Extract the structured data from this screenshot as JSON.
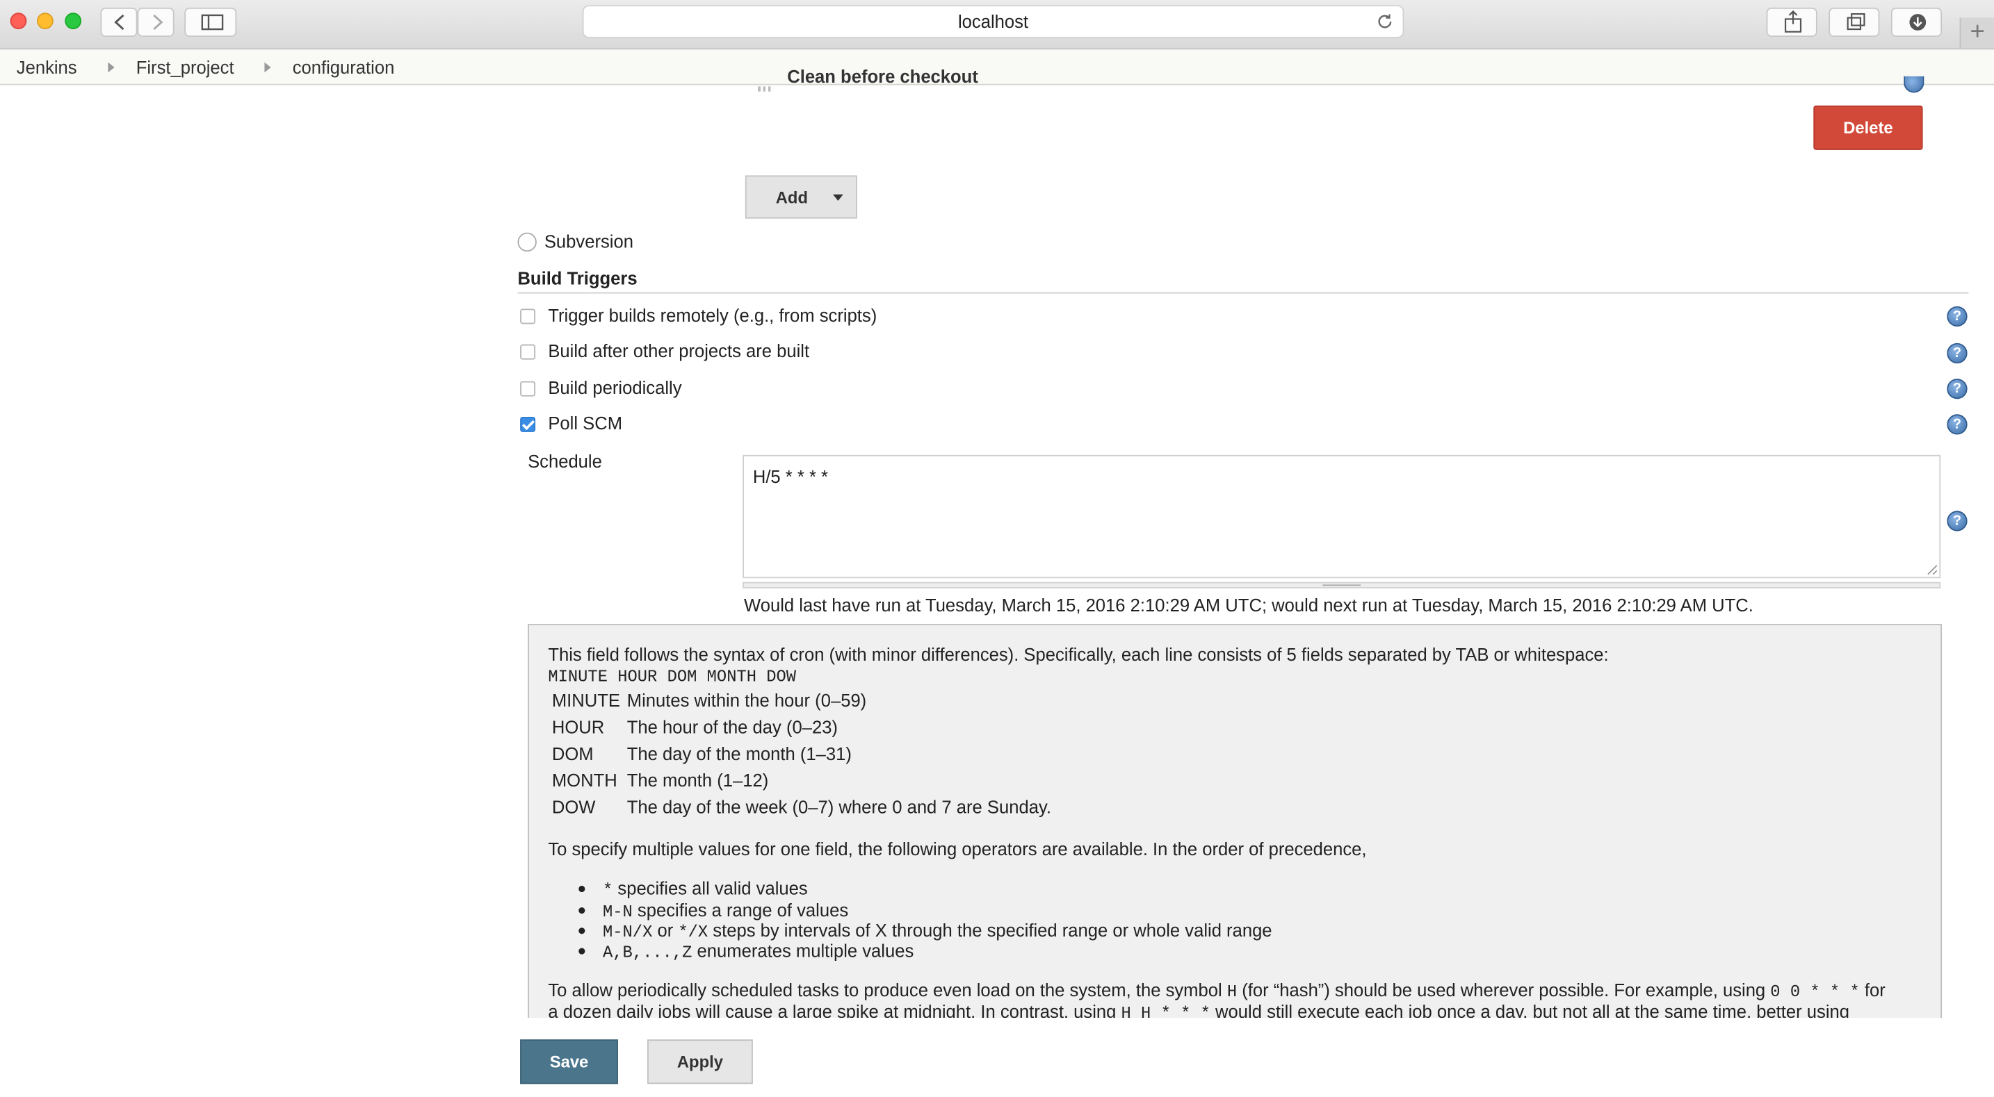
{
  "browser": {
    "url": "localhost",
    "traffic_light_colors": [
      "#fe5f57",
      "#febc2e",
      "#28c840"
    ]
  },
  "breadcrumb": [
    "Jenkins",
    "First_project",
    "configuration"
  ],
  "scm": {
    "cut_off_item": "Clean before checkout",
    "delete_label": "Delete",
    "add_label": "Add",
    "subversion_label": "Subversion"
  },
  "build_triggers": {
    "heading": "Build Triggers",
    "options": [
      {
        "label": "Trigger builds remotely (e.g., from scripts)",
        "checked": false
      },
      {
        "label": "Build after other projects are built",
        "checked": false
      },
      {
        "label": "Build periodically",
        "checked": false
      },
      {
        "label": "Poll SCM",
        "checked": true
      }
    ],
    "schedule_label": "Schedule",
    "schedule_value": "H/5 * * * *",
    "schedule_note": "Would last have run at Tuesday, March 15, 2016 2:10:29 AM UTC; would next run at Tuesday, March 15, 2016 2:10:29 AM UTC."
  },
  "help": {
    "intro": "This field follows the syntax of cron (with minor differences). Specifically, each line consists of 5 fields separated by TAB or whitespace:",
    "format": "MINUTE HOUR DOM MONTH DOW",
    "fields": [
      {
        "name": "MINUTE",
        "desc": "Minutes within the hour (0–59)"
      },
      {
        "name": "HOUR",
        "desc": "The hour of the day (0–23)"
      },
      {
        "name": "DOM",
        "desc": "The day of the month (1–31)"
      },
      {
        "name": "MONTH",
        "desc": "The month (1–12)"
      },
      {
        "name": "DOW",
        "desc": "The day of the week (0–7) where 0 and 7 are Sunday."
      }
    ],
    "operators_intro": "To specify multiple values for one field, the following operators are available. In the order of precedence,",
    "operators": [
      {
        "code": "*",
        "text": " specifies all valid values"
      },
      {
        "code": "M-N",
        "text": " specifies a range of values"
      },
      {
        "code": "M-N/X",
        "mid": " or ",
        "code2": "*/X",
        "text": " steps by intervals of X through the specified range or whole valid range"
      },
      {
        "code": "A,B,...,Z",
        "text": " enumerates multiple values"
      }
    ],
    "hash_line1_a": "To allow periodically scheduled tasks to produce even load on the system, the symbol ",
    "hash_code1": "H",
    "hash_line1_b": " (for “hash”) should be used wherever possible. For example, using ",
    "hash_code2": "0 0 * * *",
    "hash_line1_c": " for",
    "hash_line2_a": "a dozen daily jobs will cause a large spike at midnight. In contrast, using ",
    "hash_code3": "H H * * *",
    "hash_line2_b": " would still execute each job once a day, but not all at the same time, better using"
  },
  "footer": {
    "save_label": "Save",
    "apply_label": "Apply"
  }
}
